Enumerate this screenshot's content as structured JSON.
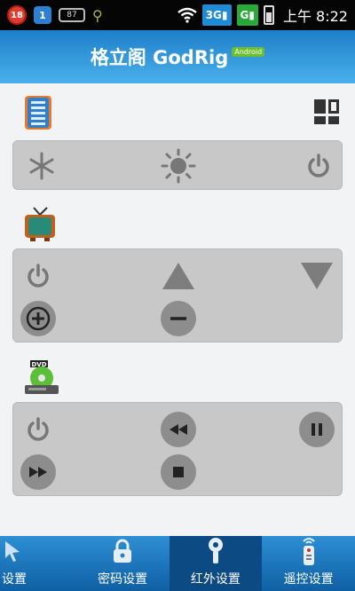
{
  "status_bar": {
    "notif_count": "18",
    "sync_label": "1",
    "battery_small": "87",
    "net_3g": "3G",
    "net_g": "G",
    "time": "上午 8:22"
  },
  "header": {
    "title": "格立阁 GodRig",
    "platform_tag": "Android"
  },
  "tabs": [
    {
      "label": "设置",
      "icon": "pointer-icon"
    },
    {
      "label": "密码设置",
      "icon": "lock-icon"
    },
    {
      "label": "红外设置",
      "icon": "ir-emitter-icon",
      "active": true
    },
    {
      "label": "遥控设置",
      "icon": "remote-icon"
    }
  ],
  "colors": {
    "header_top": "#1d7fc9",
    "header_bottom": "#4ab0ea",
    "panel_bg": "#c8c8c8",
    "button_gray": "#8d8d8d",
    "tab_active": "#0b4a83"
  }
}
